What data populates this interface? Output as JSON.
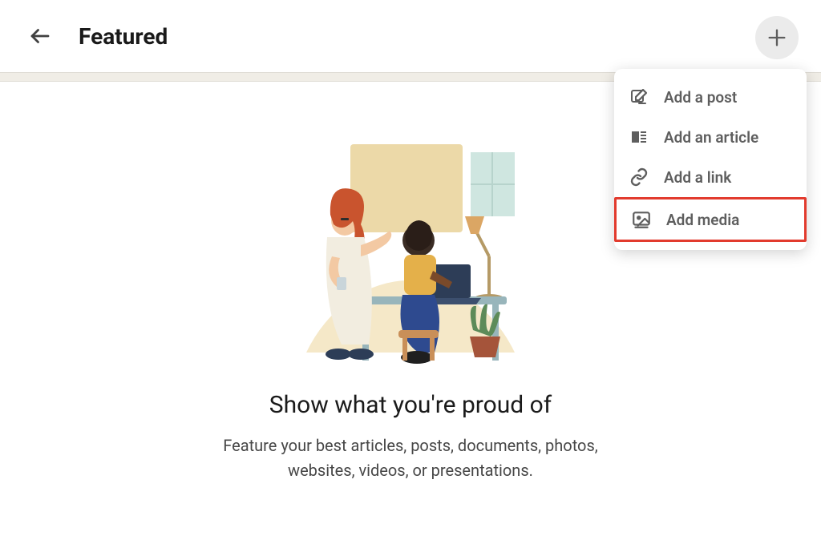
{
  "header": {
    "title": "Featured"
  },
  "content": {
    "headline": "Show what you're proud of",
    "body": "Feature your best articles, posts, documents, photos, websites, videos, or presentations."
  },
  "dropdown": {
    "items": [
      {
        "icon": "compose-icon",
        "label": "Add a post"
      },
      {
        "icon": "article-icon",
        "label": "Add an article"
      },
      {
        "icon": "link-icon",
        "label": "Add a link"
      },
      {
        "icon": "media-icon",
        "label": "Add media"
      }
    ]
  },
  "colors": {
    "highlight": "#e23b2e"
  }
}
